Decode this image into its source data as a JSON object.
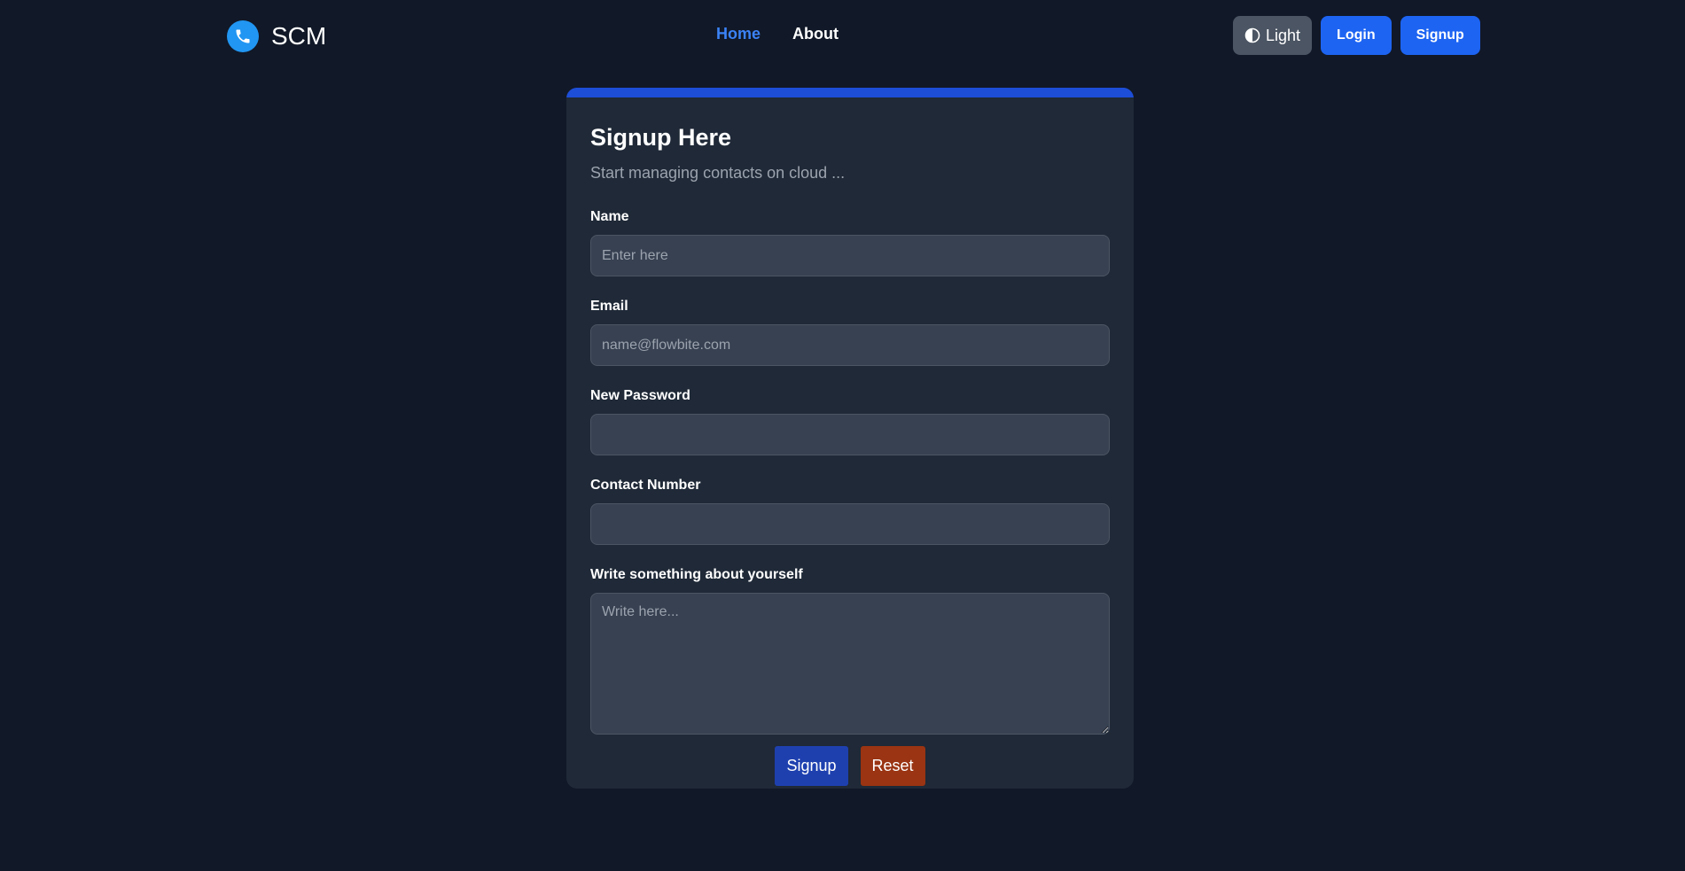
{
  "navbar": {
    "brand": {
      "name": "SCM",
      "icon": "phone-icon",
      "icon_color": "#2196f3"
    },
    "links": [
      {
        "label": "Home",
        "active": true
      },
      {
        "label": "About",
        "active": false
      }
    ],
    "theme_toggle": {
      "label": "Light",
      "icon": "half-circle-icon"
    },
    "login_label": "Login",
    "signup_label": "Signup"
  },
  "form": {
    "title": "Signup Here",
    "subtitle": "Start managing contacts on cloud ...",
    "fields": {
      "name": {
        "label": "Name",
        "placeholder": "Enter here",
        "value": ""
      },
      "email": {
        "label": "Email",
        "placeholder": "name@flowbite.com",
        "value": ""
      },
      "password": {
        "label": "New Password",
        "placeholder": "",
        "value": ""
      },
      "phone": {
        "label": "Contact Number",
        "placeholder": "",
        "value": ""
      },
      "about": {
        "label": "Write something about yourself",
        "placeholder": "Write here...",
        "value": ""
      }
    },
    "submit_label": "Signup",
    "reset_label": "Reset"
  },
  "colors": {
    "background": "#111827",
    "card": "#1f2937",
    "accent": "#1d4ed8",
    "nav_active": "#3b82f6",
    "reset": "#9a3412"
  }
}
